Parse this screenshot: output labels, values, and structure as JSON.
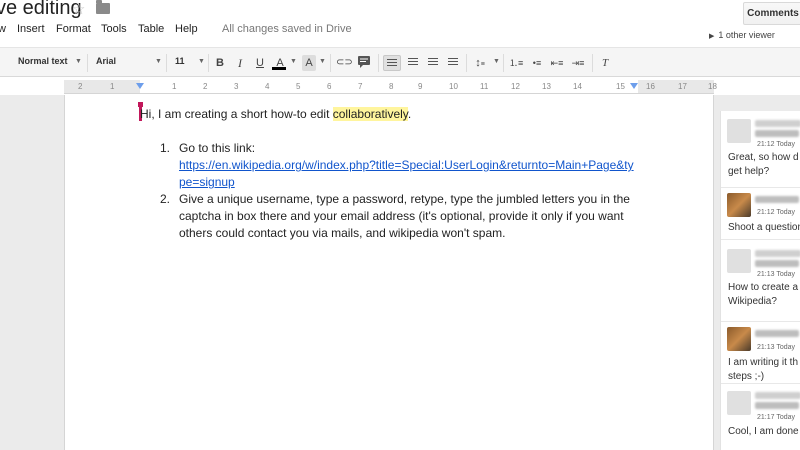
{
  "app": {
    "title": "ve editing",
    "save_status": "All changes saved in Drive",
    "comments_button": "Comments",
    "viewers": "1 other viewer"
  },
  "menu": [
    "w",
    "Insert",
    "Format",
    "Tools",
    "Table",
    "Help"
  ],
  "toolbar": {
    "style": "Normal text",
    "font": "Arial",
    "size": "11",
    "bold": "B",
    "italic": "I",
    "underline": "U",
    "text_color": "A",
    "highlight": "A",
    "clear": "T"
  },
  "ruler": [
    "2",
    "1",
    "1",
    "2",
    "3",
    "4",
    "5",
    "6",
    "7",
    "8",
    "9",
    "10",
    "11",
    "12",
    "13",
    "14",
    "15",
    "16",
    "17",
    "18"
  ],
  "document": {
    "line1_before": "Hi, I am creating a short how-to edit ",
    "line1_highlight": "collaboratively",
    "line1_after": ".",
    "list": [
      {
        "num": "1.",
        "text": "Go to this link:",
        "link_line1": "https://en.wikipedia.org/w/index.php?title=Special:UserLogin&returnto=Main+Page&ty",
        "link_line2": "pe=signup"
      },
      {
        "num": "2.",
        "line1": "Give a unique username, type a password, retype, type the jumbled letters you in the",
        "line2": "captcha in box there and your email address (it's optional, provide it only if you want",
        "line3": "others could contact you via mails, and wikipedia won't spam."
      }
    ]
  },
  "comments": [
    {
      "time": "21:12 Today",
      "line1": "Great, so how d",
      "line2": "get help?"
    },
    {
      "time": "21:12 Today",
      "line1": "Shoot a question",
      "line2": ""
    },
    {
      "time": "21:13 Today",
      "line1": "How to create a",
      "line2": "Wikipedia?"
    },
    {
      "time": "21:13 Today",
      "line1": "I am writing it th",
      "line2": "steps ;-)"
    },
    {
      "time": "21:17 Today",
      "line1": "Cool, I am done",
      "line2": ""
    }
  ],
  "colors": {
    "accent_link": "#1155cc",
    "highlight": "#fff59d",
    "cursor": "#c2185b"
  }
}
